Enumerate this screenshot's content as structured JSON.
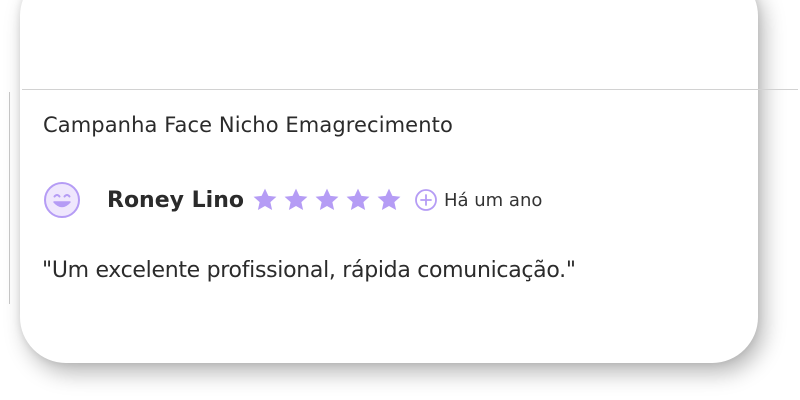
{
  "review": {
    "title": "Campanha Face Nicho Emagrecimento",
    "reviewer_name": "Roney Lino",
    "rating": 5,
    "rating_max": 5,
    "time_ago": "Há um ano",
    "quote": "\"Um excelente profissional, rápida comunicação.\""
  },
  "icons": {
    "avatar": "smiley-face-icon",
    "star": "star-icon",
    "more": "plus-circle-icon"
  },
  "colors": {
    "accent": "#b59cf5",
    "text": "#2b2b2b",
    "avatar_fill": "#efe7fd"
  }
}
